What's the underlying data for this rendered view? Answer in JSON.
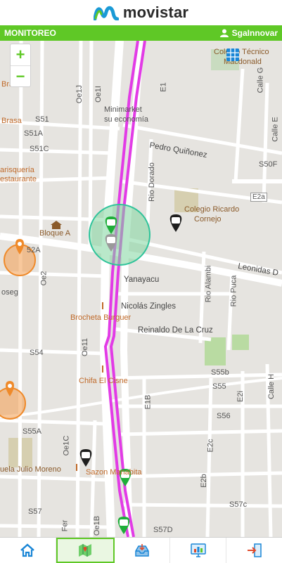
{
  "brand": {
    "name": "movistar",
    "accent": "#5fc826",
    "logo_color": "#1a9ad6"
  },
  "appbar": {
    "title": "MONITOREO",
    "user": "SgaInnovar",
    "user_icon": "user-icon"
  },
  "map": {
    "zoom_in": "+",
    "zoom_out": "−",
    "labels": {
      "brasa1": "Brasa",
      "brasa2": "Brasa",
      "marisqueria": "arisquería",
      "restaurante": "estaurante",
      "bloque_a": "Bloque A",
      "s52a": "52A",
      "oe2": "Oe2",
      "roseg": "oseg",
      "minimarket": "Minimarket",
      "su_economia": "su economía",
      "pedro": "Pedro Quiñonez",
      "colegio_ricardo": "Colegio Ricardo",
      "cornejo": "Cornejo",
      "rio_dorado": "Rio Dorado",
      "e2a": "E2a",
      "leonidas": "Leonidas D",
      "yanayacu": "Yanayacu",
      "nicolas": "Nicolás Zingles",
      "rio_alambi": "Rio Alambi",
      "rio_puca": "Rio Puca",
      "brocheta": "Brocheta Burguer",
      "reinaldo": "Reinaldo De La Cruz",
      "s54": "S54",
      "oe11": "Oe11",
      "chifa": "Chifa El Cisne",
      "e1b": "E1B",
      "s55b": "S55b",
      "s55": "S55",
      "e2i": "E2i",
      "calle_h": "Calle H",
      "s56": "S56",
      "s55a": "S55A",
      "oe1c": "Oe1C",
      "escuela": "uela Julio Moreno",
      "sazon": "Sazon Manabita",
      "e2c": "E2c",
      "e2b": "E2b",
      "s57": "S57",
      "s57c": "S57c",
      "s57d": "S57D",
      "fer": "Fer",
      "oe1b": "Oe1B",
      "s51": "S51",
      "s51a": "S51A",
      "s51c": "S51C",
      "s50f": "S50F",
      "calle_e": "Calle E",
      "calle_g": "Calle G",
      "oe1j": "Oe1J",
      "oe1i": "Oe1I",
      "colegio_tecnico": "Colegio Técnico",
      "macdonald": "Macdonald",
      "e1": "E1"
    }
  },
  "nav": {
    "home_icon": "home-icon",
    "map_icon": "map-icon",
    "inbox_icon": "inbox-icon",
    "monitor_icon": "monitor-chart-icon",
    "logout_icon": "logout-icon"
  }
}
